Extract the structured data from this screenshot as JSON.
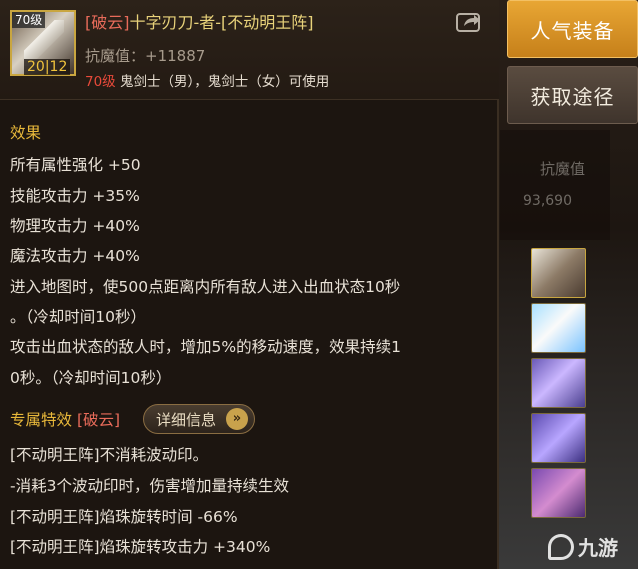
{
  "item": {
    "level_badge": "70级",
    "count": "20|12",
    "name_tag": "[破云]",
    "name_rest": "十字刃刀-者-[不动明王阵]",
    "stat": "抗魔值：+11887",
    "req_level": "70级",
    "req_classes": "鬼剑士（男），鬼剑士（女）可使用"
  },
  "effects": {
    "title": "效果",
    "lines": [
      "所有属性强化 +50",
      "技能攻击力 +35%",
      "物理攻击力 +40%",
      "魔法攻击力 +40%",
      "进入地图时，使500点距离内所有敌人进入出血状态10秒",
      "。（冷却时间10秒）",
      "攻击出血状态的敌人时，增加5%的移动速度，效果持续1",
      "0秒。（冷却时间10秒）"
    ]
  },
  "exclusive": {
    "label": "专属特效",
    "tag": "[破云]",
    "detail_button": "详细信息",
    "lines": [
      "[不动明王阵]不消耗波动印。",
      "-消耗3个波动印时，伤害增加量持续生效",
      "[不动明王阵]焰珠旋转时间 -66%",
      "[不动明王阵]焰珠旋转攻击力 +340%"
    ]
  },
  "side": {
    "popular_button": "人气装备",
    "source_button": "获取途径",
    "stat_label": "抗魔值",
    "stat_value": "93,690"
  },
  "watermark": "九游",
  "colors": {
    "accent_gold": "#e8b83a",
    "tag_red": "#e86b5a",
    "button_orange": "#e8a634"
  }
}
